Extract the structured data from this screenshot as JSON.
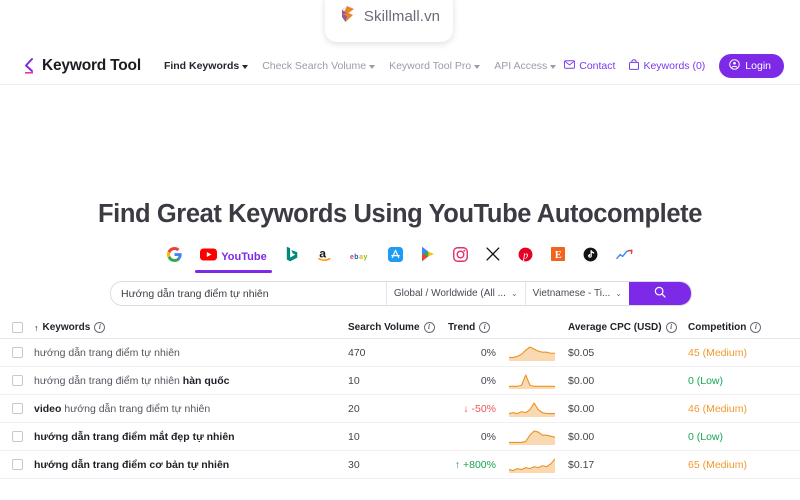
{
  "badge": {
    "name": "Skillmall.vn",
    "icon": "skillmall-logo-icon"
  },
  "navbar": {
    "brand": "Keyword Tool",
    "links": [
      {
        "label": "Find Keywords",
        "active": true
      },
      {
        "label": "Check Search Volume",
        "active": false
      },
      {
        "label": "Keyword Tool Pro",
        "active": false
      },
      {
        "label": "API Access",
        "active": false
      }
    ],
    "contact": "Contact",
    "keywords_cart": "Keywords (0)",
    "login": "Login",
    "accent": "#7c2ae8"
  },
  "hero": {
    "title": "Find Great Keywords Using YouTube Autocomplete"
  },
  "platforms": [
    {
      "name": "Google",
      "icon": "google-icon",
      "label": "",
      "active": false
    },
    {
      "name": "YouTube",
      "icon": "youtube-icon",
      "label": "YouTube",
      "active": true
    },
    {
      "name": "Bing",
      "icon": "bing-icon",
      "label": "",
      "active": false
    },
    {
      "name": "Amazon",
      "icon": "amazon-icon",
      "label": "",
      "active": false
    },
    {
      "name": "eBay",
      "icon": "ebay-icon",
      "label": "",
      "active": false
    },
    {
      "name": "App Store",
      "icon": "appstore-icon",
      "label": "",
      "active": false
    },
    {
      "name": "Google Play",
      "icon": "googleplay-icon",
      "label": "",
      "active": false
    },
    {
      "name": "Instagram",
      "icon": "instagram-icon",
      "label": "",
      "active": false
    },
    {
      "name": "X",
      "icon": "x-twitter-icon",
      "label": "",
      "active": false
    },
    {
      "name": "Pinterest",
      "icon": "pinterest-icon",
      "label": "",
      "active": false
    },
    {
      "name": "Etsy",
      "icon": "etsy-icon",
      "label": "",
      "active": false
    },
    {
      "name": "TikTok",
      "icon": "tiktok-icon",
      "label": "",
      "active": false
    },
    {
      "name": "Google Trends",
      "icon": "trends-icon",
      "label": "",
      "active": false
    }
  ],
  "search": {
    "query": "Hướng dẫn trang điểm tự nhiên",
    "placeholder": "Hướng dẫn trang điểm tự nhiên",
    "location": "Global / Worldwide (All ...",
    "language": "Vietnamese - Ti...",
    "button_icon": "search-icon"
  },
  "table": {
    "headers": {
      "keywords": "Keywords",
      "sort_indicator": "↑",
      "search_volume": "Search Volume",
      "trend": "Trend",
      "cpc": "Average CPC (USD)",
      "competition": "Competition"
    },
    "rows": [
      {
        "keyword_plain": "hướng dẫn trang điểm tự nhiên",
        "keyword_prefix": "",
        "keyword_bold": "",
        "keyword_suffix": "hướng dẫn trang điểm tự nhiên",
        "all_bold": false,
        "volume": "470",
        "trend": "0%",
        "trend_dir": "flat",
        "cpc": "$0.05",
        "competition": "45 (Medium)",
        "competition_level": "medium"
      },
      {
        "keyword_plain": "hướng dẫn trang điểm tự nhiên hàn quốc",
        "keyword_prefix": "hướng dẫn trang điểm tự nhiên ",
        "keyword_bold": "hàn quốc",
        "keyword_suffix": "",
        "all_bold": false,
        "volume": "10",
        "trend": "0%",
        "trend_dir": "flat",
        "cpc": "$0.00",
        "competition": "0 (Low)",
        "competition_level": "low"
      },
      {
        "keyword_plain": "video hướng dẫn trang điểm tự nhiên",
        "keyword_prefix": "",
        "keyword_bold": "video",
        "keyword_suffix": " hướng dẫn trang điểm tự nhiên",
        "all_bold": false,
        "volume": "20",
        "trend": "-50%",
        "trend_dir": "down",
        "cpc": "$0.00",
        "competition": "46 (Medium)",
        "competition_level": "medium"
      },
      {
        "keyword_plain": "hướng dẫn trang điểm mắt đẹp tự nhiên",
        "keyword_prefix": "",
        "keyword_bold": "",
        "keyword_suffix": "hướng dẫn trang điểm mắt đẹp tự nhiên",
        "all_bold": true,
        "volume": "10",
        "trend": "0%",
        "trend_dir": "flat",
        "cpc": "$0.00",
        "competition": "0 (Low)",
        "competition_level": "low"
      },
      {
        "keyword_plain": "hướng dẫn trang điểm cơ bản tự nhiên",
        "keyword_prefix": "",
        "keyword_bold": "",
        "keyword_suffix": "hướng dẫn trang điểm cơ bản tự nhiên",
        "all_bold": true,
        "volume": "30",
        "trend": "+800%",
        "trend_dir": "up",
        "cpc": "$0.17",
        "competition": "65 (Medium)",
        "competition_level": "medium"
      }
    ],
    "sparklines": [
      [
        2,
        2,
        3,
        5,
        9,
        12,
        10,
        8,
        7,
        7,
        6,
        6
      ],
      [
        1,
        1,
        1,
        2,
        11,
        2,
        1,
        1,
        1,
        1,
        1,
        1
      ],
      [
        2,
        3,
        2,
        4,
        3,
        6,
        13,
        6,
        3,
        2,
        2,
        2
      ],
      [
        1,
        1,
        1,
        1,
        2,
        8,
        12,
        11,
        8,
        8,
        7,
        6
      ],
      [
        2,
        1,
        3,
        2,
        4,
        3,
        5,
        4,
        6,
        5,
        8,
        13
      ]
    ],
    "colors": {
      "sparkline": "#ed9121",
      "medium": "#f0992e",
      "low": "#1aa85a",
      "up": "#14a44d",
      "down": "#f2555a"
    }
  }
}
